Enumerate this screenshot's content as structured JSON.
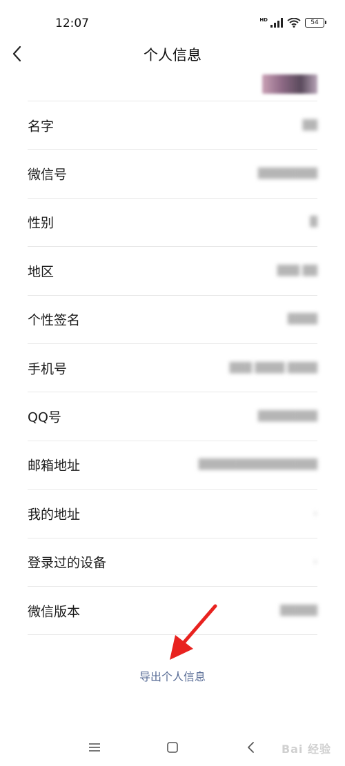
{
  "status": {
    "time": "12:07",
    "hd": "HD",
    "battery": "54"
  },
  "header": {
    "title": "个人信息"
  },
  "rows": [
    {
      "label": "名字",
      "value": "██"
    },
    {
      "label": "微信号",
      "value": "████████"
    },
    {
      "label": "性别",
      "value": "█"
    },
    {
      "label": "地区",
      "value": "███ ██"
    },
    {
      "label": "个性签名",
      "value": "████"
    },
    {
      "label": "手机号",
      "value": "███ ████ ████"
    },
    {
      "label": "QQ号",
      "value": "████████"
    },
    {
      "label": "邮箱地址",
      "value": "████████████████"
    },
    {
      "label": "我的地址",
      "value": "›"
    },
    {
      "label": "登录过的设备",
      "value": "›"
    },
    {
      "label": "微信版本",
      "value": "█████"
    }
  ],
  "export": {
    "label": "导出个人信息"
  },
  "watermark": {
    "text": "Bai 经验"
  },
  "colors": {
    "link": "#576b95",
    "arrow": "#e8221f",
    "divider": "#e8e8e8"
  }
}
